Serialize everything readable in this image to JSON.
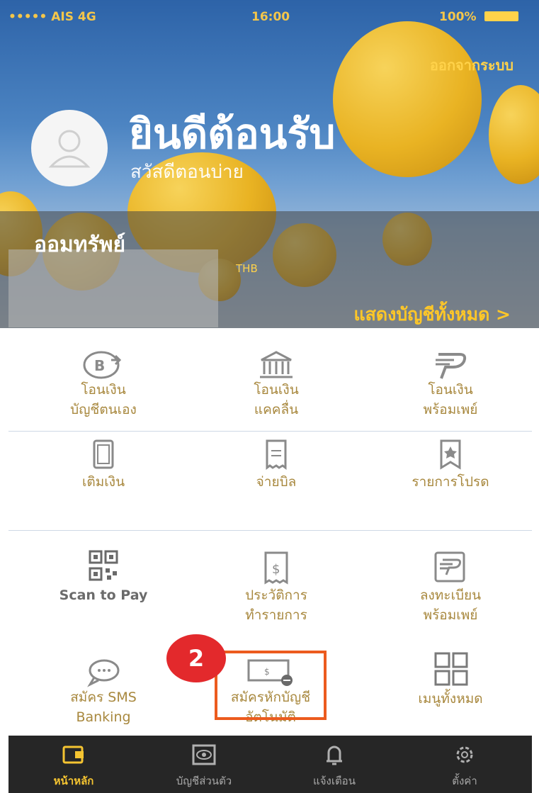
{
  "status_bar": {
    "carrier": "••••• AIS  4G",
    "time": "16:00",
    "battery": "100%"
  },
  "header": {
    "logout": "ออกจากระบบ",
    "greeting": "ยินดีต้อนรับ",
    "subgreeting": "สวัสดีตอนบ่าย"
  },
  "account": {
    "name": "ออมทรัพย์",
    "currency": "THB",
    "show_all": "แสดงบัญชีทั้งหมด >"
  },
  "menu": [
    {
      "icon": "transfer-own-account-icon",
      "label1": "โอนเงิน",
      "label2": "บัญชีตนเอง"
    },
    {
      "icon": "bank-icon",
      "label1": "โอนเงิน",
      "label2": "แคคลื่น"
    },
    {
      "icon": "promptpay-icon",
      "label1": "โอนเงิน",
      "label2": "พร้อมเพย์"
    },
    {
      "icon": "topup-icon",
      "label1": "เติมเงิน",
      "label2": ""
    },
    {
      "icon": "bill-icon",
      "label1": "จ่ายบิล",
      "label2": ""
    },
    {
      "icon": "favorite-icon",
      "label1": "รายการโปรด",
      "label2": ""
    },
    {
      "icon": "qr-code-icon",
      "label1": "Scan to Pay",
      "label2": ""
    },
    {
      "icon": "history-icon",
      "label1": "ประวัติการ",
      "label2": "ทำรายการ"
    },
    {
      "icon": "promptpay-register-icon",
      "label1": "ลงทะเบียน",
      "label2": "พร้อมเพย์"
    },
    {
      "icon": "sms-icon",
      "label1": "สมัคร SMS",
      "label2": "Banking"
    },
    {
      "icon": "auto-debit-icon",
      "label1": "สมัครหักบัญชี",
      "label2": "อัตโนมัติ"
    },
    {
      "icon": "all-menu-icon",
      "label1": "เมนูทั้งหมด",
      "label2": ""
    }
  ],
  "annotation": {
    "step": "2"
  },
  "tabbar": [
    {
      "icon": "wallet-icon",
      "label": "หน้าหลัก",
      "active": true
    },
    {
      "icon": "eye-card-icon",
      "label": "บัญชีส่วนตัว",
      "active": false
    },
    {
      "icon": "bell-icon",
      "label": "แจ้งเตือน",
      "active": false
    },
    {
      "icon": "gear-icon",
      "label": "ตั้งค่า",
      "active": false
    }
  ],
  "colors": {
    "accent": "#f5c431",
    "highlight": "#ec5b1e",
    "badge": "#e3292c",
    "label": "#a8883e"
  }
}
